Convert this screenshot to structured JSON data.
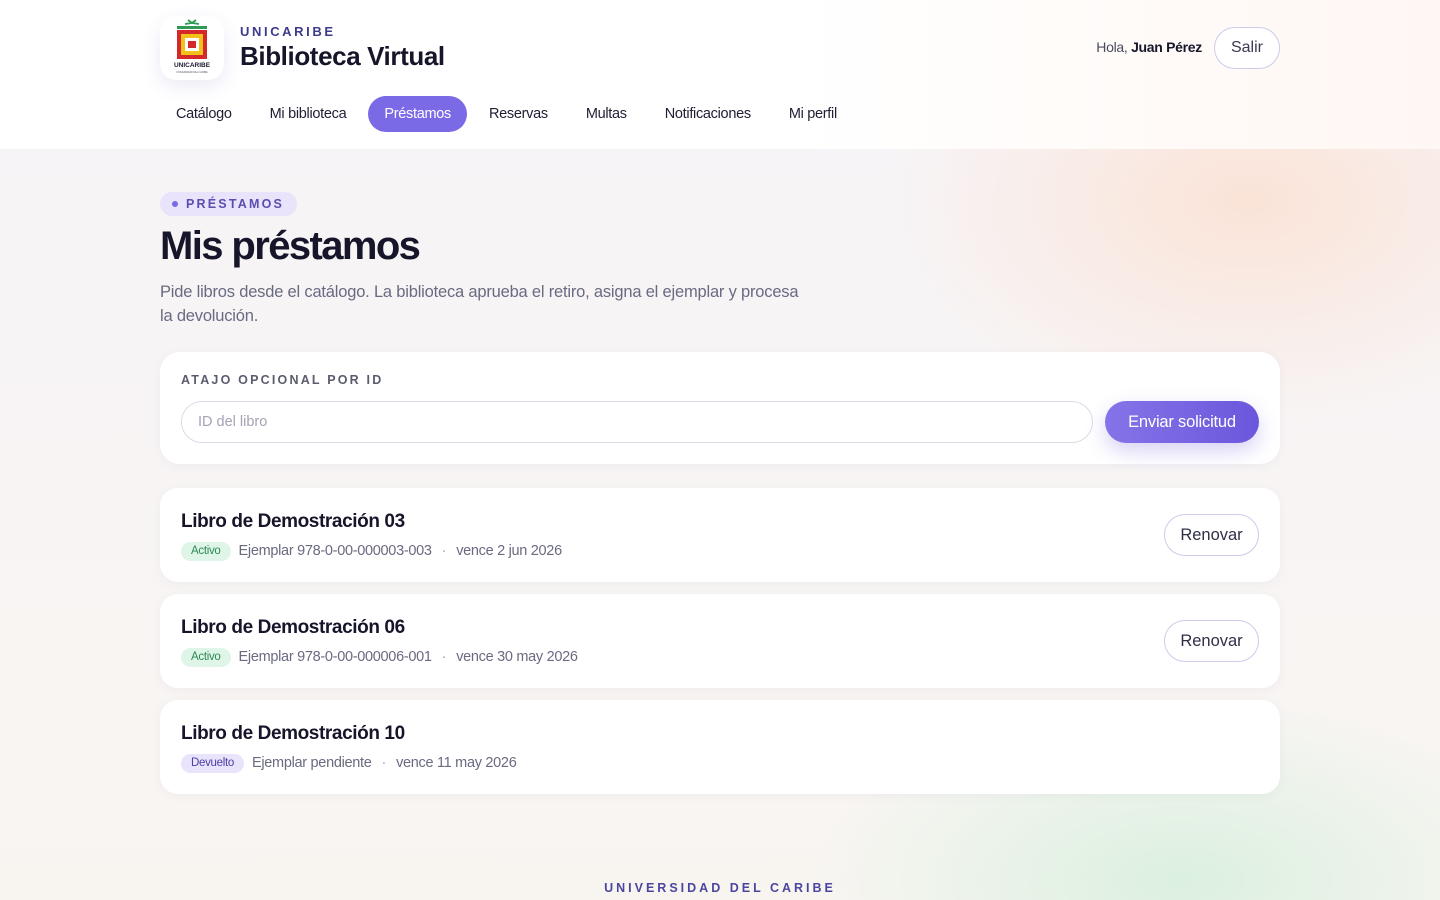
{
  "brand": {
    "eyebrow": "UNICARIBE",
    "title": "Biblioteca Virtual",
    "logo_text": "UNICARIBE",
    "logo_tagline": "UNIVERSIDAD DEL CARIBE"
  },
  "user": {
    "greeting": "Hola,",
    "name": "Juan Pérez",
    "logout_label": "Salir"
  },
  "nav": {
    "tabs": [
      {
        "label": "Catálogo",
        "active": false
      },
      {
        "label": "Mi biblioteca",
        "active": false
      },
      {
        "label": "Préstamos",
        "active": true
      },
      {
        "label": "Reservas",
        "active": false
      },
      {
        "label": "Multas",
        "active": false
      },
      {
        "label": "Notificaciones",
        "active": false
      },
      {
        "label": "Mi perfil",
        "active": false
      }
    ]
  },
  "page": {
    "eyebrow": "PRÉSTAMOS",
    "title": "Mis préstamos",
    "subtitle": "Pide libros desde el catálogo. La biblioteca aprueba el retiro, asigna el ejemplar y procesa la devolución."
  },
  "shortcut": {
    "label": "ATAJO OPCIONAL POR ID",
    "input_placeholder": "ID del libro",
    "input_value": "",
    "submit_label": "Enviar solicitud"
  },
  "loans": [
    {
      "title": "Libro de Demostración 03",
      "status": "Activo",
      "status_color": "#2c8a56",
      "copy": "Ejemplar 978-0-00-000003-003",
      "due": "vence 2 jun 2026",
      "action": "Renovar"
    },
    {
      "title": "Libro de Demostración 06",
      "status": "Activo",
      "status_color": "#2c8a56",
      "copy": "Ejemplar 978-0-00-000006-001",
      "due": "vence 30 may 2026",
      "action": "Renovar"
    },
    {
      "title": "Libro de Demostración 10",
      "status": "Devuelto",
      "status_color": "#4b3fa5",
      "copy": "Ejemplar pendiente",
      "due": "vence 11 may 2026",
      "action": ""
    }
  ],
  "footer": {
    "text": "UNIVERSIDAD DEL CARIBE"
  },
  "colors": {
    "accent": "#7b6ae6",
    "brand_dark": "#3e3a8c",
    "active_badge_bg": "#dff5e7",
    "returned_badge_bg": "#e9e3fb"
  },
  "separator": "·"
}
